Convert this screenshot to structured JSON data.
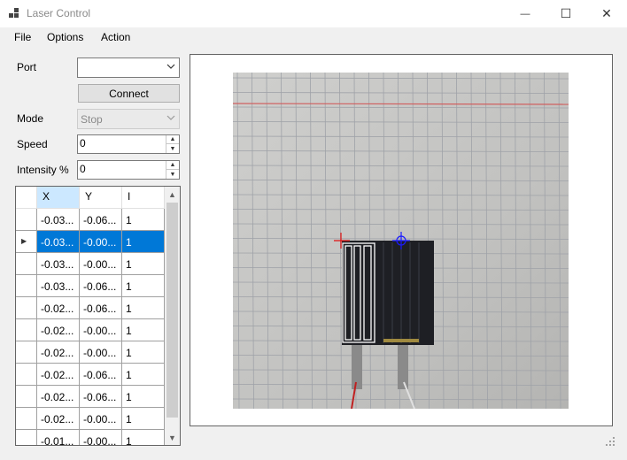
{
  "window": {
    "title": "Laser Control",
    "minimize_glyph": "—",
    "maximize_glyph": "☐",
    "close_glyph": "✕"
  },
  "menu": [
    "File",
    "Options",
    "Action"
  ],
  "controls": {
    "port_label": "Port",
    "port_value": "",
    "connect_label": "Connect",
    "mode_label": "Mode",
    "mode_value": "Stop",
    "speed_label": "Speed",
    "speed_value": "0",
    "intensity_label": "Intensity %",
    "intensity_value": "0"
  },
  "grid": {
    "columns": [
      "X",
      "Y",
      "I"
    ],
    "rows": [
      [
        "-0.03...",
        "-0.06...",
        "1"
      ],
      [
        "-0.03...",
        "-0.00...",
        "1"
      ],
      [
        "-0.03...",
        "-0.00...",
        "1"
      ],
      [
        "-0.03...",
        "-0.06...",
        "1"
      ],
      [
        "-0.02...",
        "-0.06...",
        "1"
      ],
      [
        "-0.02...",
        "-0.00...",
        "1"
      ],
      [
        "-0.02...",
        "-0.00...",
        "1"
      ],
      [
        "-0.02...",
        "-0.06...",
        "1"
      ],
      [
        "-0.02...",
        "-0.06...",
        "1"
      ],
      [
        "-0.02...",
        "-0.00...",
        "1"
      ],
      [
        "-0.01...",
        "-0.00...",
        "1"
      ]
    ],
    "selected_row": 1,
    "selected_column_header": 0
  },
  "colors": {
    "selection": "#0078d7",
    "header_selected": "#cce8ff",
    "marker_red": "#e01010",
    "marker_blue": "#1a1aff"
  },
  "icons": {
    "app": "app-grid-icon",
    "dropdown": "chevron-down-icon",
    "row_indicator": "triangle-right-icon",
    "resize": "resize-grip-icon"
  }
}
